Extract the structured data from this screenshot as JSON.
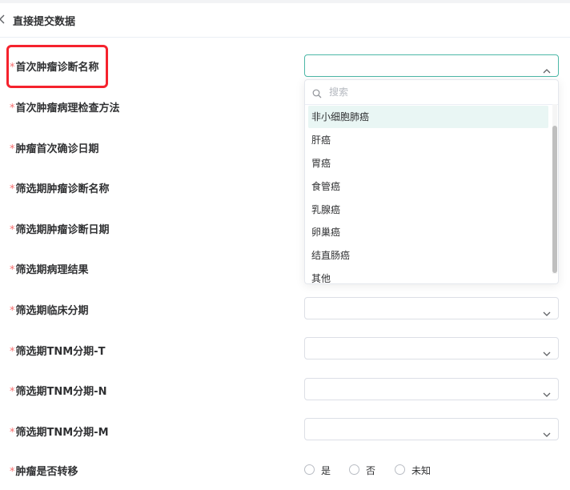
{
  "header": {
    "title": "直接提交数据"
  },
  "form": {
    "fields": [
      {
        "label": "首次肿瘤诊断名称",
        "required": "*",
        "value": ""
      },
      {
        "label": "首次肿瘤病理检查方法",
        "required": "*",
        "value": ""
      },
      {
        "label": "肿瘤首次确诊日期",
        "required": "*",
        "value": ""
      },
      {
        "label": "筛选期肿瘤诊断名称",
        "required": "*",
        "value": ""
      },
      {
        "label": "筛选期肿瘤诊断日期",
        "required": "*",
        "value": ""
      },
      {
        "label": "筛选期病理结果",
        "required": "*",
        "value": ""
      },
      {
        "label": "筛选期临床分期",
        "required": "*",
        "value": ""
      },
      {
        "label": "筛选期TNM分期-T",
        "required": "*",
        "value": ""
      },
      {
        "label": "筛选期TNM分期-N",
        "required": "*",
        "value": ""
      },
      {
        "label": "筛选期TNM分期-M",
        "required": "*",
        "value": ""
      },
      {
        "label": "肿瘤是否转移",
        "required": "*",
        "value": ""
      }
    ]
  },
  "dropdown": {
    "search_placeholder": "搜索",
    "options": [
      "非小细胞肺癌",
      "肝癌",
      "胃癌",
      "食管癌",
      "乳腺癌",
      "卵巢癌",
      "结直肠癌",
      "其他"
    ],
    "hovered_index": 0
  },
  "metastasis": {
    "options": [
      "是",
      "否",
      "未知"
    ]
  },
  "colors": {
    "required": "#f56c6c",
    "highlight": "#f5222d",
    "active_border": "#4cb8a7",
    "hover_bg": "#e9f6f4"
  },
  "icons": {
    "back": "chevron-left-icon",
    "search": "search-icon",
    "expand": "chevron-down-icon",
    "collapse": "chevron-up-icon"
  }
}
